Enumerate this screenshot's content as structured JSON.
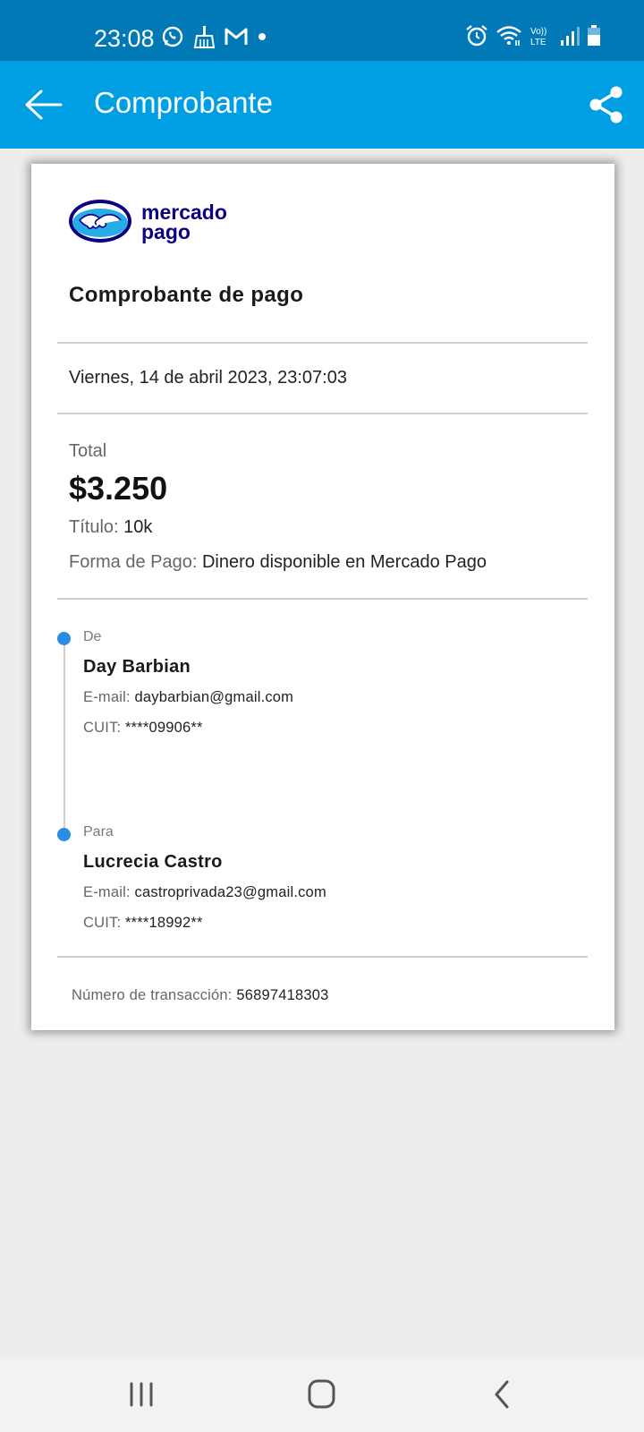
{
  "status_bar": {
    "time": "23:08",
    "icons_left": [
      "whatsapp-icon",
      "cleaner-icon",
      "gmail-icon",
      "dot-icon"
    ],
    "icons_right": [
      "alarm-icon",
      "wifi-icon",
      "volte-icon",
      "signal-icon",
      "battery-icon"
    ],
    "volte_label": "Vo)) LTE"
  },
  "app_bar": {
    "title": "Comprobante",
    "back_icon": "arrow-left-icon",
    "share_icon": "share-icon"
  },
  "receipt": {
    "brand": "mercado pago",
    "brand_line1": "mercado",
    "brand_line2": "pago",
    "title": "Comprobante de pago",
    "date": "Viernes, 14 de abril 2023, 23:07:03",
    "total_label": "Total",
    "total_amount": "$3.250",
    "titulo_label": "Título:",
    "titulo_value": "10k",
    "forma_label": "Forma de Pago:",
    "forma_value": "Dinero disponible en Mercado Pago",
    "from": {
      "label": "De",
      "name": "Day Barbian",
      "email_label": "E-mail:",
      "email": "daybarbian@gmail.com",
      "cuit_label": "CUIT:",
      "cuit": "****09906**"
    },
    "to": {
      "label": "Para",
      "name": "Lucrecia Castro",
      "email_label": "E-mail:",
      "email": "castroprivada23@gmail.com",
      "cuit_label": "CUIT:",
      "cuit": "****18992**"
    },
    "tx_label": "Número de transacción:",
    "tx_value": "56897418303"
  },
  "colors": {
    "status_bar": "#0079b6",
    "app_bar": "#009ee3",
    "timeline_dot": "#2a8ce3",
    "brand_navy": "#0a0080",
    "brand_cyan": "#009ee3"
  },
  "nav_bar": {
    "recents_icon": "recents-icon",
    "home_icon": "home-icon",
    "back_icon": "nav-back-icon"
  }
}
